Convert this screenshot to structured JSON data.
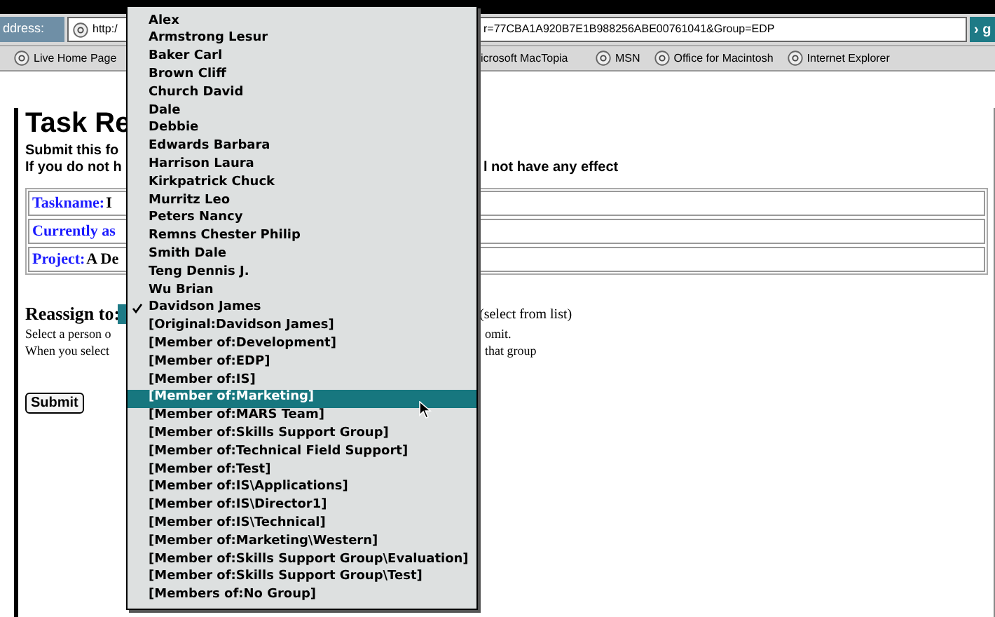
{
  "address_bar": {
    "label": "ddress:",
    "url_start": "http:/",
    "url_end": "r=77CBA1A920B7E1B988256ABE00761041&Group=EDP",
    "go_button": "› g"
  },
  "favorites": [
    {
      "label": "Live Home Page"
    },
    {
      "label": "icrosoft MacTopia"
    },
    {
      "label": "MSN"
    },
    {
      "label": "Office for Macintosh"
    },
    {
      "label": "Internet Explorer"
    }
  ],
  "page": {
    "heading": "Task Re",
    "line_1": "Submit this fo",
    "line_2_start": "If you do not h",
    "line_2_end": "l not have any effect",
    "fields": [
      {
        "label": "Taskname:",
        "value": "I"
      },
      {
        "label": "Currently as"
      },
      {
        "label": "Project:",
        "value": "A De"
      }
    ],
    "reassign_label": "Reassign to:",
    "reassign_hint": "(select from list)",
    "help_1_start": "Select a person o",
    "help_1_end": "omit.",
    "help_2_start": "When you select",
    "help_2_end": "that group",
    "submit": "Submit"
  },
  "dropdown": {
    "items": [
      {
        "label": "Alex",
        "checked": false,
        "selected": false
      },
      {
        "label": "Armstrong Lesur",
        "checked": false,
        "selected": false
      },
      {
        "label": "Baker Carl",
        "checked": false,
        "selected": false
      },
      {
        "label": "Brown Cliff",
        "checked": false,
        "selected": false
      },
      {
        "label": "Church David",
        "checked": false,
        "selected": false
      },
      {
        "label": "Dale",
        "checked": false,
        "selected": false
      },
      {
        "label": "Debbie",
        "checked": false,
        "selected": false
      },
      {
        "label": "Edwards Barbara",
        "checked": false,
        "selected": false
      },
      {
        "label": "Harrison Laura",
        "checked": false,
        "selected": false
      },
      {
        "label": "Kirkpatrick Chuck",
        "checked": false,
        "selected": false
      },
      {
        "label": "Murritz Leo",
        "checked": false,
        "selected": false
      },
      {
        "label": "Peters Nancy",
        "checked": false,
        "selected": false
      },
      {
        "label": "Remns Chester Philip",
        "checked": false,
        "selected": false
      },
      {
        "label": "Smith Dale",
        "checked": false,
        "selected": false
      },
      {
        "label": "Teng Dennis J.",
        "checked": false,
        "selected": false
      },
      {
        "label": "Wu Brian",
        "checked": false,
        "selected": false
      },
      {
        "label": "Davidson James",
        "checked": true,
        "selected": false
      },
      {
        "label": "[Original:Davidson James]",
        "checked": false,
        "selected": false
      },
      {
        "label": "[Member of:Development]",
        "checked": false,
        "selected": false
      },
      {
        "label": "[Member of:EDP]",
        "checked": false,
        "selected": false
      },
      {
        "label": "[Member of:IS]",
        "checked": false,
        "selected": false
      },
      {
        "label": "[Member of:Marketing]",
        "checked": false,
        "selected": true
      },
      {
        "label": "[Member of:MARS Team]",
        "checked": false,
        "selected": false
      },
      {
        "label": "[Member of:Skills Support Group]",
        "checked": false,
        "selected": false
      },
      {
        "label": "[Member of:Technical Field Support]",
        "checked": false,
        "selected": false
      },
      {
        "label": "[Member of:Test]",
        "checked": false,
        "selected": false
      },
      {
        "label": "[Member of:IS\\Applications]",
        "checked": false,
        "selected": false
      },
      {
        "label": "[Member of:IS\\Director1]",
        "checked": false,
        "selected": false
      },
      {
        "label": "[Member of:IS\\Technical]",
        "checked": false,
        "selected": false
      },
      {
        "label": "[Member of:Marketing\\Western]",
        "checked": false,
        "selected": false
      },
      {
        "label": "[Member of:Skills Support Group\\Evaluation]",
        "checked": false,
        "selected": false
      },
      {
        "label": "[Member of:Skills Support Group\\Test]",
        "checked": false,
        "selected": false
      },
      {
        "label": "[Members of:No Group]",
        "checked": false,
        "selected": false
      }
    ]
  }
}
